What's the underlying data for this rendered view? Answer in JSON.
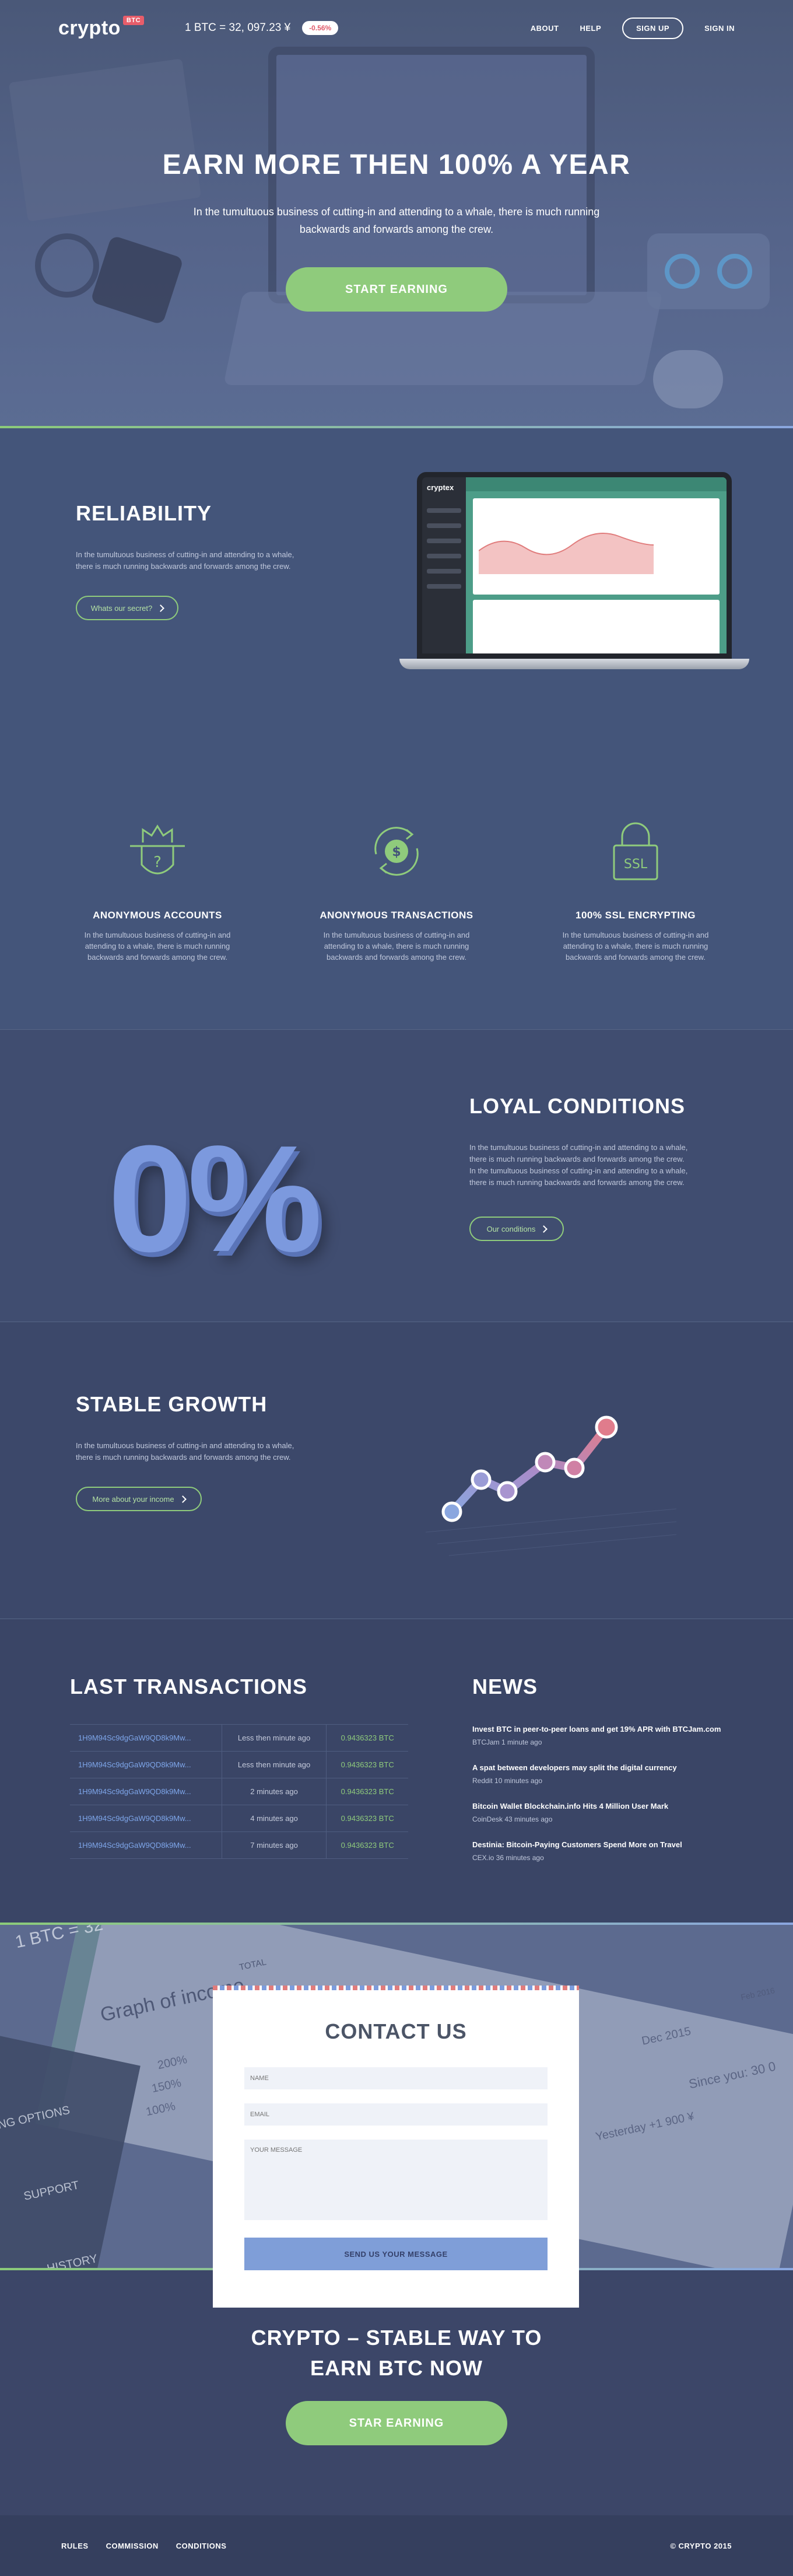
{
  "header": {
    "logo": "crypto",
    "logo_badge": "BTC",
    "rate": "1 BTC = 32, 097.23 ¥",
    "rate_change": "-0.56%",
    "nav": [
      "ABOUT",
      "HELP",
      "SIGN UP",
      "SIGN IN"
    ]
  },
  "hero": {
    "title": "EARN MORE THEN 100% A YEAR",
    "subtitle": "In the tumultuous business of cutting-in and attending to a whale, there is much running backwards and forwards among the crew.",
    "button": "START EARNING"
  },
  "reliability": {
    "title": "RELIABILITY",
    "text": "In the tumultuous business of cutting-in and attending to a whale, there is much running backwards and forwards among the crew.",
    "button": "Whats our secret?",
    "app_brand": "cryptex"
  },
  "features": [
    {
      "title": "ANONYMOUS ACCOUNTS",
      "text": "In the tumultuous business of cutting-in and attending to a whale, there is much running backwards and forwards among the crew.",
      "icon": "anonymous-icon"
    },
    {
      "title": "ANONYMOUS TRANSACTIONS",
      "text": "In the tumultuous business of cutting-in and attending to a whale, there is much running backwards and forwards among the crew.",
      "icon": "dollar-exchange-icon"
    },
    {
      "title": "100% SSL ENCRYPTING",
      "text": "In the tumultuous business of cutting-in and attending to a whale, there is much running backwards and forwards among the crew.",
      "icon": "ssl-lock-icon",
      "icon_text": "SSL"
    }
  ],
  "loyal": {
    "big_text": "0%",
    "title": "LOYAL CONDITIONS",
    "text": "In the tumultuous business of cutting-in and attending to a whale, there is much running backwards and forwards among the crew. In the tumultuous business of cutting-in and attending to a whale, there is much running backwards and forwards among the crew.",
    "button": "Our conditions"
  },
  "stable": {
    "title": "STABLE GROWTH",
    "text": "In the tumultuous business of cutting-in and attending to a whale, there is much running backwards and forwards among the crew.",
    "button": "More about your income"
  },
  "transactions": {
    "title": "LAST TRANSACTIONS",
    "rows": [
      {
        "address": "1H9M94Sc9dgGaW9QD8k9Mw...",
        "time": "Less then minute ago",
        "amount": "0.9436323 BTC"
      },
      {
        "address": "1H9M94Sc9dgGaW9QD8k9Mw...",
        "time": "Less then minute ago",
        "amount": "0.9436323 BTC"
      },
      {
        "address": "1H9M94Sc9dgGaW9QD8k9Mw...",
        "time": "2 minutes ago",
        "amount": "0.9436323 BTC"
      },
      {
        "address": "1H9M94Sc9dgGaW9QD8k9Mw...",
        "time": "4 minutes ago",
        "amount": "0.9436323 BTC"
      },
      {
        "address": "1H9M94Sc9dgGaW9QD8k9Mw...",
        "time": "7 minutes ago",
        "amount": "0.9436323 BTC"
      }
    ]
  },
  "news": {
    "title": "NEWS",
    "items": [
      {
        "title": "Invest BTC in peer-to-peer loans and get 19% APR with BTCJam.com",
        "meta": "BTCJam 1 minute ago"
      },
      {
        "title": "A spat between developers may split the digital currency",
        "meta": "Reddit 10 minutes ago"
      },
      {
        "title": "Bitcoin Wallet Blockchain.info Hits 4 Million User Mark",
        "meta": "CoinDesk 43 minutes ago"
      },
      {
        "title": "Destinia: Bitcoin-Paying Customers Spend More on Travel",
        "meta": "CEX.io 36 minutes ago"
      }
    ]
  },
  "contact": {
    "title": "CONTACT US",
    "name_placeholder": "NAME",
    "email_placeholder": "EMAIL",
    "message_placeholder": "YOUR MESSAGE",
    "button": "SEND US YOUR MESSAGE",
    "bg_texts": [
      "1 BTC = 32",
      "Graph of income",
      "TOTAL",
      "200%",
      "150%",
      "100%",
      "ING OPTIONS",
      "SUPPORT",
      "HISTORY",
      "Dec 2015",
      "Feb 2016",
      "Yesterday +1 900 ¥",
      "Since you: 30 0"
    ]
  },
  "cta": {
    "title_line1": "CRYPTO – STABLE WAY TO",
    "title_line2": "EARN BTC NOW",
    "button": "STAR EARNING"
  },
  "footer": {
    "links": [
      "RULES",
      "COMMISSION",
      "CONDITIONS"
    ],
    "copyright": "© CRYPTO 2015"
  },
  "colors": {
    "accent_green": "#8fcb7c",
    "accent_blue": "#7f9ed8",
    "accent_red": "#e85d6a"
  }
}
